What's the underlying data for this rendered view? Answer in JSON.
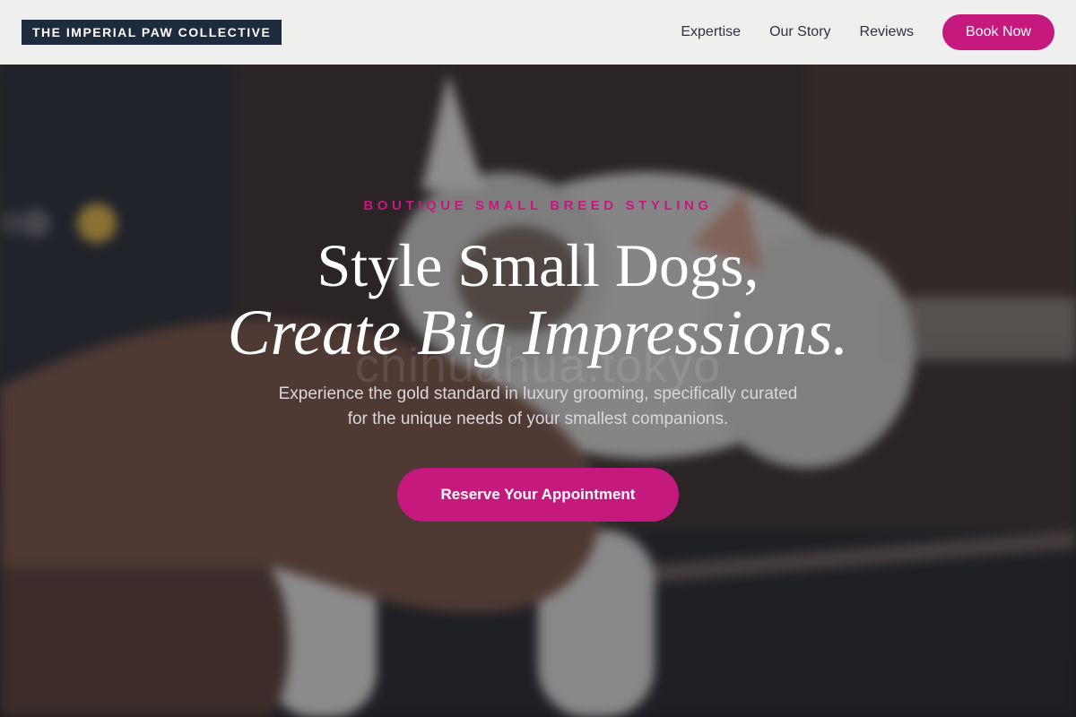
{
  "header": {
    "brand": "THE IMPERIAL PAW COLLECTIVE",
    "nav": [
      {
        "label": "Expertise"
      },
      {
        "label": "Our Story"
      },
      {
        "label": "Reviews"
      }
    ],
    "book_label": "Book Now"
  },
  "hero": {
    "eyebrow": "BOUTIQUE SMALL BREED STYLING",
    "headline_line1": "Style Small Dogs,",
    "headline_line2": "Create Big Impressions.",
    "watermark": "chihuahua.tokyo",
    "subheadline_line1": "Experience the gold standard in luxury grooming, specifically curated",
    "subheadline_line2": "for the unique needs of your smallest companions.",
    "cta_label": "Reserve Your Appointment"
  },
  "colors": {
    "accent": "#c6197e",
    "brand_bg": "#1e2a3e",
    "header_bg": "#efefee"
  }
}
